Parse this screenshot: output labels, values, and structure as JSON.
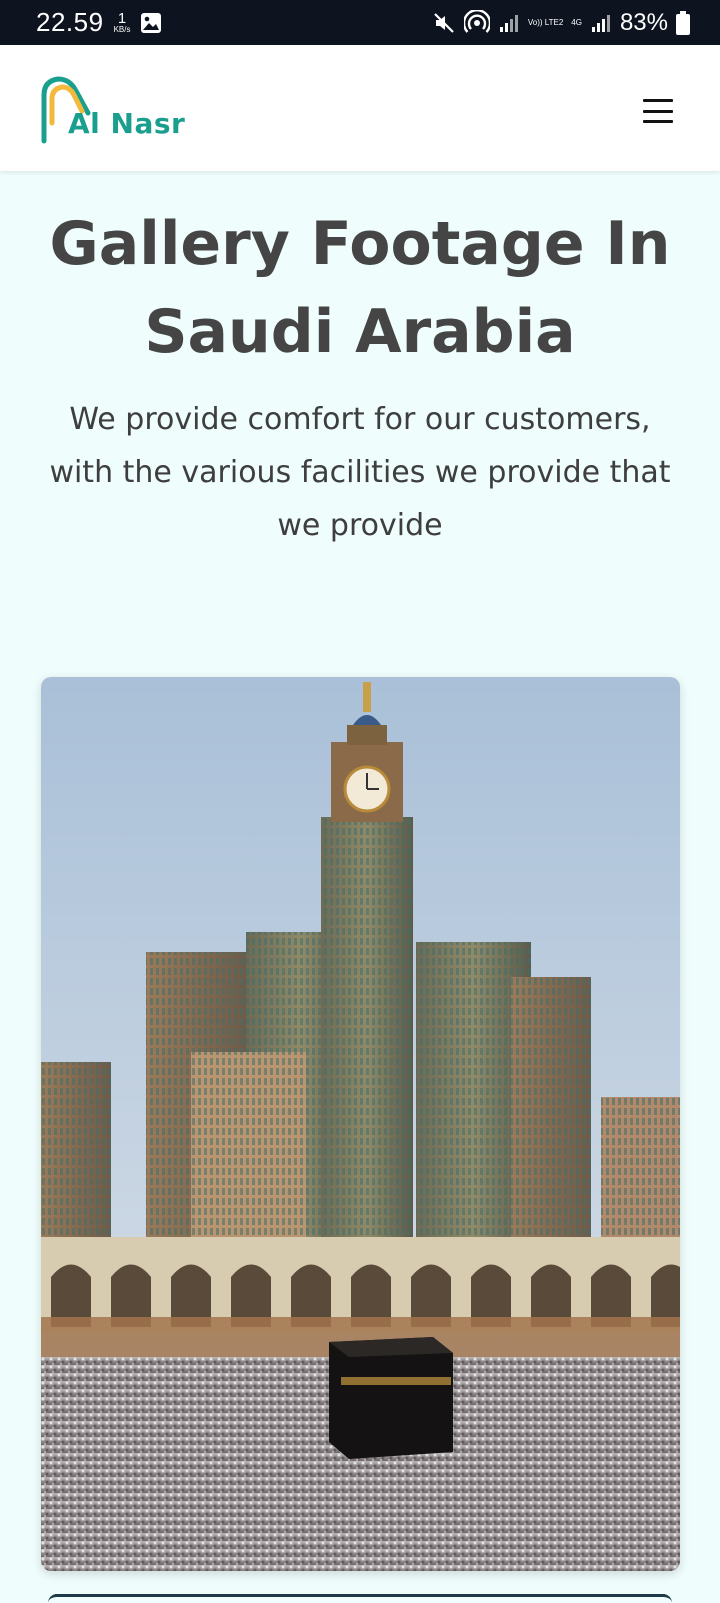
{
  "status_bar": {
    "time": "22.59",
    "speed_value": "1",
    "speed_unit": "KB/s",
    "network_volte": "Vo)) LTE2",
    "network_type": "4G",
    "battery": "83%",
    "icons": [
      "image-icon",
      "mute-icon",
      "hotspot-icon",
      "signal-icon",
      "signal-icon",
      "battery-icon"
    ]
  },
  "header": {
    "logo_text": "Al Nasr",
    "menu_icon": "hamburger-menu-icon"
  },
  "hero": {
    "title": "Gallery Footage In Saudi Arabia",
    "subtitle": "We provide comfort for our customers, with the various facilities we provide that we provide"
  },
  "gallery": {
    "image_subject": "Makkah clock tower and Kaaba with pilgrims"
  },
  "colors": {
    "brand_teal": "#1a9f8f",
    "brand_yellow": "#f2b93b",
    "page_bg": "#effdfd",
    "status_bg": "#0d1420",
    "title_text": "#454545"
  }
}
